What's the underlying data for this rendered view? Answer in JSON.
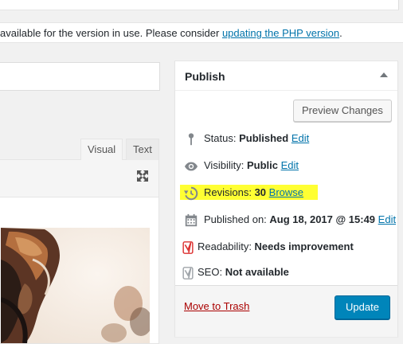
{
  "notice": {
    "text": "available for the version in use. Please consider ",
    "link": "updating the PHP version",
    "suffix": "."
  },
  "editor": {
    "tabs": [
      {
        "label": "Visual"
      },
      {
        "label": "Text"
      }
    ]
  },
  "publish": {
    "title": "Publish",
    "preview_label": "Preview Changes",
    "status": {
      "label": "Status: ",
      "value": "Published",
      "edit": "Edit"
    },
    "visibility": {
      "label": "Visibility: ",
      "value": "Public",
      "edit": "Edit"
    },
    "revisions": {
      "label": "Revisions: ",
      "value": "30",
      "link": "Browse"
    },
    "published_on": {
      "label": "Published on: ",
      "value": "Aug 18, 2017 @ 15:49",
      "edit": "Edit"
    },
    "readability": {
      "label": "Readability: ",
      "value": "Needs improvement"
    },
    "seo": {
      "label": "SEO: ",
      "value": "Not available"
    },
    "trash_label": "Move to Trash",
    "update_label": "Update"
  },
  "colors": {
    "link": "#0073aa",
    "primary_button": "#0085ba",
    "trash": "#a00",
    "highlight": "#ffff33",
    "readability_icon": "#dc3232"
  }
}
